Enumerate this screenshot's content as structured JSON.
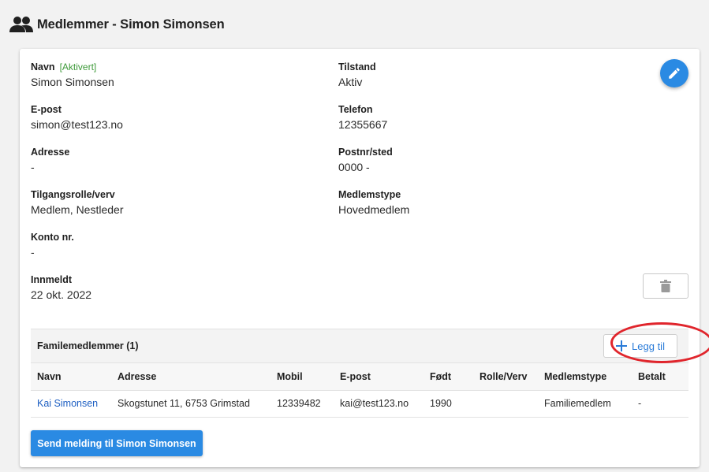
{
  "header": {
    "title": "Medlemmer - Simon Simonsen",
    "icon": "people-icon"
  },
  "member": {
    "name": {
      "label": "Navn",
      "badge": "[Aktivert]",
      "value": "Simon Simonsen"
    },
    "status": {
      "label": "Tilstand",
      "value": "Aktiv"
    },
    "email": {
      "label": "E-post",
      "value": "simon@test123.no"
    },
    "phone": {
      "label": "Telefon",
      "value": "12355667"
    },
    "address": {
      "label": "Adresse",
      "value": "-"
    },
    "postal": {
      "label": "Postnr/sted",
      "value": "0000 -"
    },
    "role": {
      "label": "Tilgangsrolle/verv",
      "value": "Medlem, Nestleder"
    },
    "type": {
      "label": "Medlemstype",
      "value": "Hovedmedlem"
    },
    "account": {
      "label": "Konto nr.",
      "value": "-"
    },
    "joined": {
      "label": "Innmeldt",
      "value": "22 okt. 2022"
    }
  },
  "actions": {
    "edit_icon": "pencil-icon",
    "delete_icon": "trash-icon"
  },
  "family": {
    "title": "Familemedlemmer (1)",
    "add_label": "Legg til",
    "columns": [
      "Navn",
      "Adresse",
      "Mobil",
      "E-post",
      "Født",
      "Rolle/Verv",
      "Medlemstype",
      "Betalt"
    ],
    "rows": [
      [
        "Kai Simonsen",
        "Skogstunet 11, 6753 Grimstad",
        "12339482",
        "kai@test123.no",
        "1990",
        "",
        "Familiemedlem",
        "-"
      ]
    ]
  },
  "send_button_label": "Send melding til Simon Simonsen",
  "colors": {
    "accent": "#2a8ae3",
    "status_green": "#3e9a3a",
    "link": "#1e5fc2",
    "highlight": "#e0252c"
  }
}
